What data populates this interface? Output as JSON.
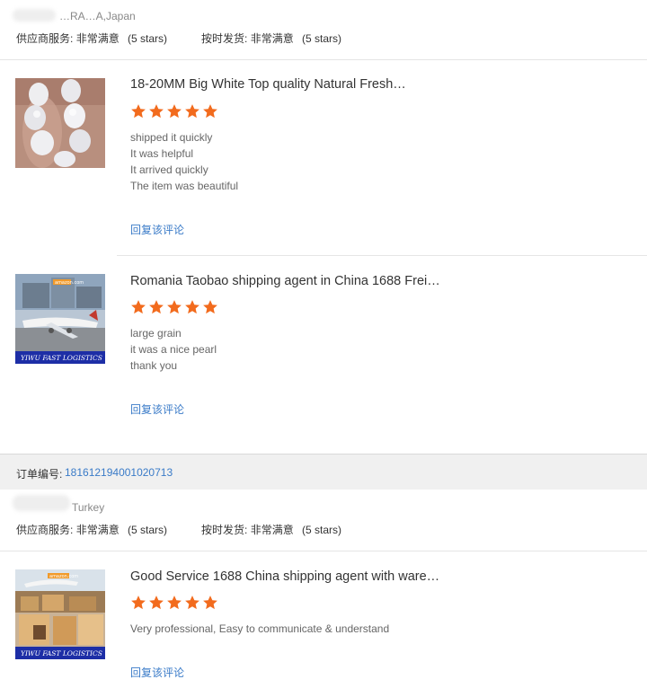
{
  "review1": {
    "buyer_location": "Japan",
    "buyer_masked": "…RA…A,Japan",
    "supplier_service_label": "供应商服务:",
    "supplier_service_value": "非常满意",
    "supplier_service_stars": "(5 stars)",
    "ontime_label": "按时发货:",
    "ontime_value": "非常满意",
    "ontime_stars": "(5 stars)",
    "items": [
      {
        "title": "18-20MM Big White Top quality Natural Fresh…",
        "rating": 5,
        "lines": [
          "shipped it quickly",
          "It was helpful",
          "It arrived quickly",
          "The item was beautiful"
        ],
        "reply": "回复该评论"
      },
      {
        "title": "Romania Taobao shipping agent in China 1688 Frei…",
        "rating": 5,
        "lines": [
          "large grain",
          "it was a nice pearl",
          "thank you"
        ],
        "reply": "回复该评论"
      }
    ]
  },
  "order": {
    "label": "订单编号:",
    "number": "181612194001020713"
  },
  "review2": {
    "buyer_masked": "Turkey",
    "supplier_service_label": "供应商服务:",
    "supplier_service_value": "非常满意",
    "supplier_service_stars": "(5 stars)",
    "ontime_label": "按时发货:",
    "ontime_value": "非常满意",
    "ontime_stars": "(5 stars)",
    "items": [
      {
        "title": "Good Service 1688 China shipping agent with ware…",
        "rating": 5,
        "lines": [
          "Very professional, Easy to communicate & understand"
        ],
        "reply": "回复该评论"
      }
    ]
  },
  "thumb_texts": {
    "logistics_banner": "YIWU FAST LOGISTICS",
    "amazon_sign": "amazon.com"
  },
  "colors": {
    "star": "#f26b1d",
    "link": "#3a7bc8",
    "order_bar": "#f0f0f0"
  }
}
